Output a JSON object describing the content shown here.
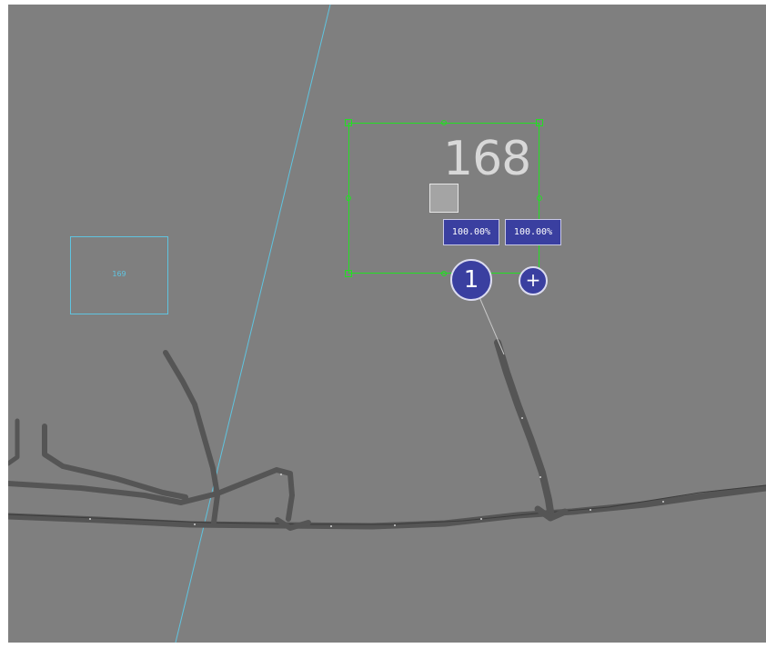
{
  "canvas": {
    "background_color": "#7f7f7f",
    "boundary_line_color": "#5fc4e0",
    "road_color": "#555555",
    "selection_color": "#22e022"
  },
  "reference_box": {
    "label": "169"
  },
  "selected_element": {
    "number": "168",
    "percent_1": "100.00%",
    "percent_2": "100.00%",
    "swatch_color": "#a4a4a4"
  },
  "marker": {
    "label": "1",
    "color": "#3a3fa0"
  },
  "add_button": {
    "label": "+"
  }
}
